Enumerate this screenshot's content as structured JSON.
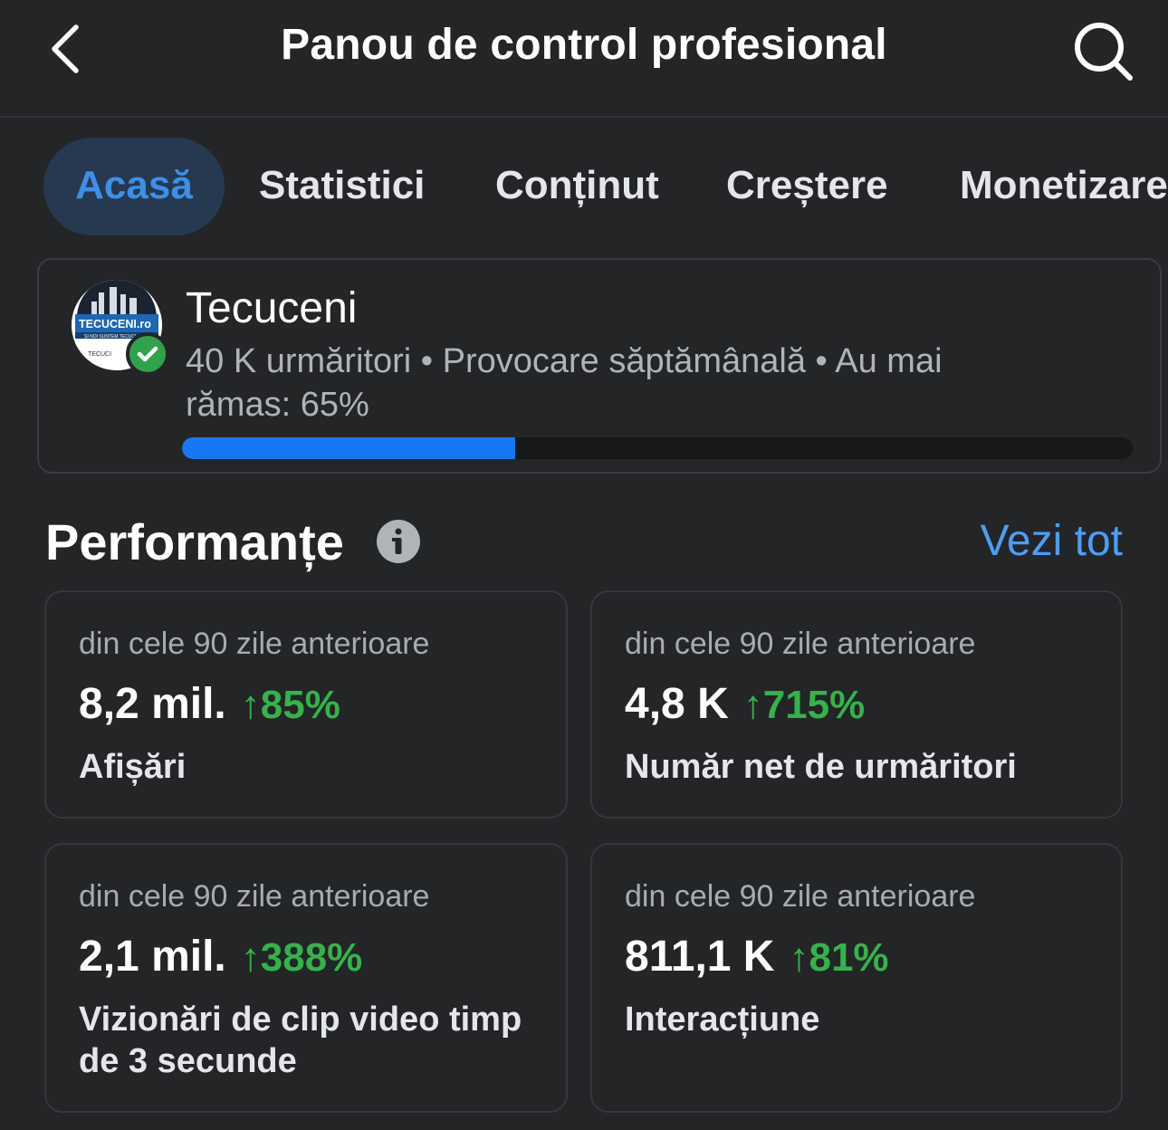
{
  "header": {
    "title": "Panou de control profesional"
  },
  "tabs": [
    {
      "label": "Acasă",
      "active": true
    },
    {
      "label": "Statistici",
      "active": false
    },
    {
      "label": "Conținut",
      "active": false
    },
    {
      "label": "Creștere",
      "active": false
    },
    {
      "label": "Monetizare",
      "active": false
    }
  ],
  "profile": {
    "name": "Tecuceni",
    "meta": "40 K urmăritori • Provocare săptămânală • Au mai rămas: 65%",
    "progress_fraction": 0.35,
    "avatar_text": "TECUCENI.ro",
    "avatar_subtext": "ȘI NOI SUNTEM TECUCI",
    "avatar_bottom_text": "TECUCI"
  },
  "performance": {
    "title": "Performanțe",
    "see_all": "Vezi tot",
    "metrics": [
      {
        "period": "din cele 90 zile anterioare",
        "value": "8,2 mil.",
        "change": "↑85%",
        "label": "Afișări"
      },
      {
        "period": "din cele 90 zile anterioare",
        "value": "4,8 K",
        "change": "↑715%",
        "label": "Număr net de urmăritori"
      },
      {
        "period": "din cele 90 zile anterioare",
        "value": "2,1 mil.",
        "change": "↑388%",
        "label": "Vizionări de clip video timp de 3 secunde"
      },
      {
        "period": "din cele 90 zile anterioare",
        "value": "811,1 K",
        "change": "↑81%",
        "label": "Interacțiune"
      }
    ]
  },
  "colors": {
    "accent": "#1877f2",
    "positive": "#34b34a",
    "link": "#4d9df4",
    "background": "#242527"
  },
  "icons": [
    "chevron-left-icon",
    "search-icon",
    "info-icon",
    "verified-check-icon"
  ]
}
